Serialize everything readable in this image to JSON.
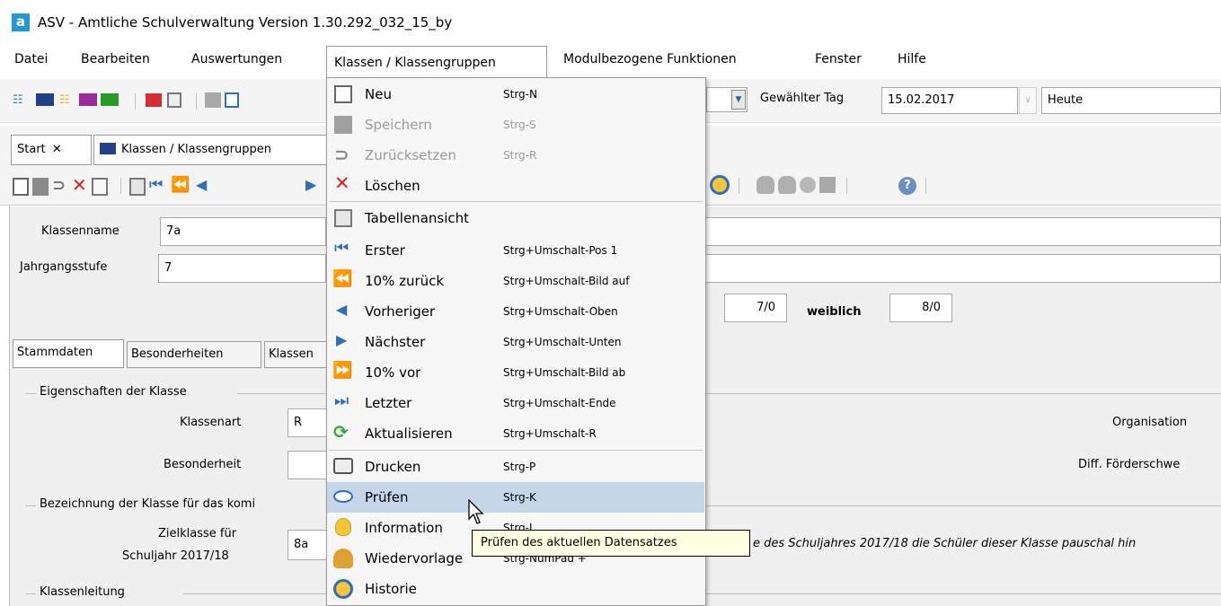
{
  "window": {
    "title": "ASV - Amtliche Schulverwaltung Version 1.30.292_032_15_by",
    "logo_letter": "a"
  },
  "menubar": [
    "Datei",
    "Bearbeiten",
    "Auswertungen",
    "Klassen / Klassengruppen",
    "Modulbezogene Funktionen",
    "Fenster",
    "Hilfe"
  ],
  "toolbar": {
    "gewaehlter_tag_label": "Gewählter Tag",
    "date_value": "15.02.2017",
    "heute_value": "Heute"
  },
  "tabs": {
    "start": "Start",
    "close_glyph": "✕",
    "klassen": "Klassen / Klassengruppen"
  },
  "form": {
    "klassenname_label": "Klassenname",
    "klassenname_value": "7a",
    "jahrgangsstufe_label": "Jahrgangsstufe",
    "jahrgangsstufe_value": "7",
    "count1": "7/0",
    "weiblich_label": "weiblich",
    "count2": "8/0",
    "inner_tabs": [
      "Stammdaten",
      "Besonderheiten",
      "Klassen"
    ],
    "eigenschaften_title": "Eigenschaften der Klasse",
    "klassenart_label": "Klassenart",
    "klassenart_value": "R",
    "besonderheit_label": "Besonderheit",
    "organisation_label": "Organisation",
    "diff_label": "Diff. Förderschwe",
    "bezeichnung_title": "Bezeichnung der Klasse für das komi",
    "zielklasse_label_1": "Zielklasse für",
    "zielklasse_label_2": "Schuljahr 2017/18",
    "zielklasse_value": "8a",
    "hint_text": "e des Schuljahres 2017/18 die Schüler dieser Klasse pauschal hin",
    "klassenleitung_title": "Klassenleitung"
  },
  "dropdown": [
    {
      "label": "Neu",
      "shortcut": "Strg-N",
      "icon": "new-icon",
      "disabled": false
    },
    {
      "label": "Speichern",
      "shortcut": "Strg-S",
      "icon": "save-icon",
      "disabled": true
    },
    {
      "label": "Zurücksetzen",
      "shortcut": "Strg-R",
      "icon": "reset-icon",
      "disabled": true
    },
    {
      "label": "Löschen",
      "shortcut": "",
      "icon": "delete-icon",
      "disabled": false
    },
    {
      "label": "Tabellenansicht",
      "shortcut": "",
      "icon": "table-view-icon",
      "disabled": false
    },
    {
      "label": "Erster",
      "shortcut": "Strg+Umschalt-Pos 1",
      "icon": "first-icon",
      "disabled": false
    },
    {
      "label": "10% zurück",
      "shortcut": "Strg+Umschalt-Bild auf",
      "icon": "back-10-icon",
      "disabled": false
    },
    {
      "label": "Vorheriger",
      "shortcut": "Strg+Umschalt-Oben",
      "icon": "previous-icon",
      "disabled": false
    },
    {
      "label": "Nächster",
      "shortcut": "Strg+Umschalt-Unten",
      "icon": "next-icon",
      "disabled": false
    },
    {
      "label": "10% vor",
      "shortcut": "Strg+Umschalt-Bild ab",
      "icon": "forward-10-icon",
      "disabled": false
    },
    {
      "label": "Letzter",
      "shortcut": "Strg+Umschalt-Ende",
      "icon": "last-icon",
      "disabled": false
    },
    {
      "label": "Aktualisieren",
      "shortcut": "Strg+Umschalt-R",
      "icon": "refresh-icon",
      "disabled": false
    },
    {
      "label": "Drucken",
      "shortcut": "Strg-P",
      "icon": "print-icon",
      "disabled": false
    },
    {
      "label": "Prüfen",
      "shortcut": "Strg-K",
      "icon": "check-eye-icon",
      "disabled": false
    },
    {
      "label": "Information",
      "shortcut": "Strg-I",
      "icon": "info-bulb-icon",
      "disabled": false
    },
    {
      "label": "Wiedervorlage",
      "shortcut": "Strg-NumPad +",
      "icon": "bell-icon",
      "disabled": false
    },
    {
      "label": "Historie",
      "shortcut": "",
      "icon": "history-clock-icon",
      "disabled": false
    }
  ],
  "tooltip": "Prüfen des aktuellen Datensatzes",
  "colors": {
    "brand": "#1f9ad6",
    "hover": "#c5d6e9",
    "tooltip_bg": "#ffffe1",
    "delete_red": "#e02020"
  }
}
